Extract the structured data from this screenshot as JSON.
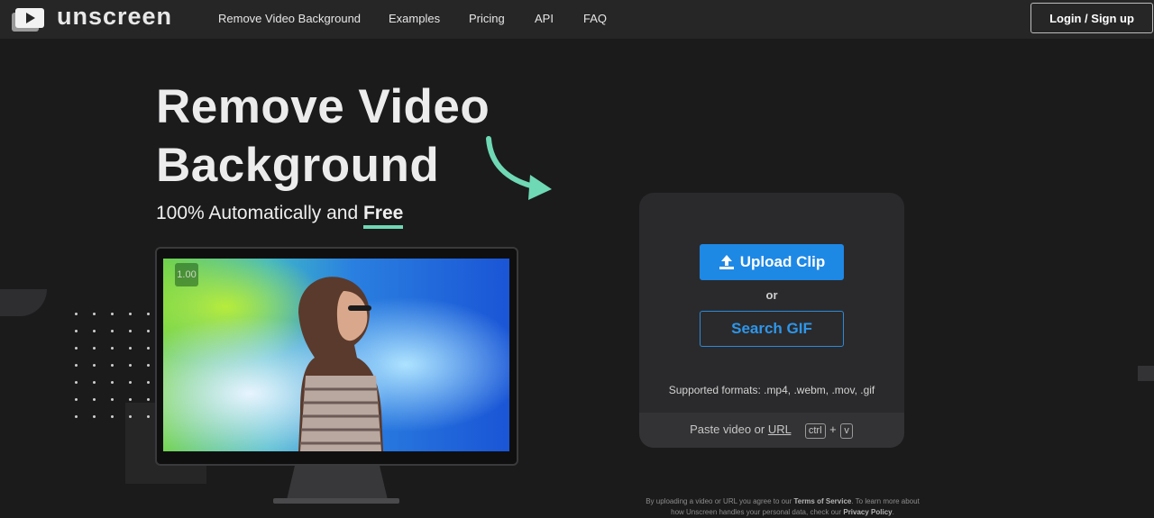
{
  "nav": {
    "logo_text": "unscreen",
    "links": [
      "Remove Video Background",
      "Examples",
      "Pricing",
      "API",
      "FAQ"
    ],
    "login_label": "Login / Sign up"
  },
  "hero": {
    "title_line1": "Remove Video",
    "title_line2": "Background",
    "subtitle_prefix": "100% Automatically and ",
    "subtitle_emphasis": "Free",
    "accent_color": "#6fd8b4"
  },
  "video": {
    "speed_badge": "1.00"
  },
  "upload": {
    "upload_label": "Upload Clip",
    "upload_icon": "upload-icon",
    "or_label": "or",
    "gif_label": "Search GIF",
    "formats": "Supported formats: .mp4, .webm, .mov, .gif",
    "paste_prefix": "Paste video or ",
    "paste_url": "URL",
    "key_ctrl": "ctrl",
    "key_plus": "+",
    "key_v": "v",
    "button_color": "#1e88e5"
  },
  "legal": {
    "line1_prefix": "By uploading a video or URL you agree to our ",
    "terms": "Terms of Service",
    "line1_suffix": ". To learn more about",
    "line2_prefix": "how Unscreen handles your personal data, check our ",
    "privacy": "Privacy Policy",
    "line2_suffix": "."
  }
}
